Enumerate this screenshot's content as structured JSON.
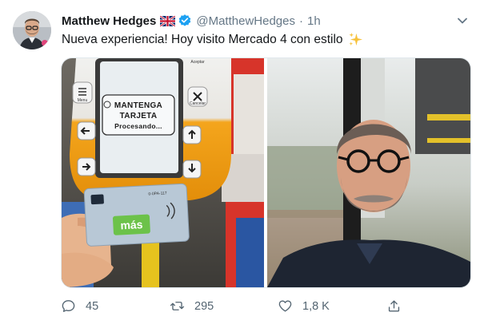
{
  "tweet": {
    "author_name": "Matthew Hedges",
    "flag_icon": "uk-flag-icon",
    "verified_icon": "verified-badge-icon",
    "handle": "@MatthewHedges",
    "separator": "·",
    "time": "1h",
    "text": "Nueva experiencia! Hoy visito Mercado 4 con estilo",
    "emoji": "sparkles-icon",
    "colors": {
      "verified": "#1da1f2",
      "muted": "#657786",
      "validator_orange": "#f5a623",
      "card_blue": "#b8c8d6",
      "card_green": "#6cc24a"
    }
  },
  "photo_left": {
    "screen_lines": [
      "MANTENGA",
      "TARJETA",
      "Procesando..."
    ],
    "menu_label": "Menu",
    "cancel_label": "Cancelar",
    "accept_label": "Aceptar",
    "card_number": "0-0PA-117",
    "card_brand": "más"
  },
  "stats": {
    "replies": "45",
    "retweets": "295",
    "likes": "1,8 K"
  }
}
